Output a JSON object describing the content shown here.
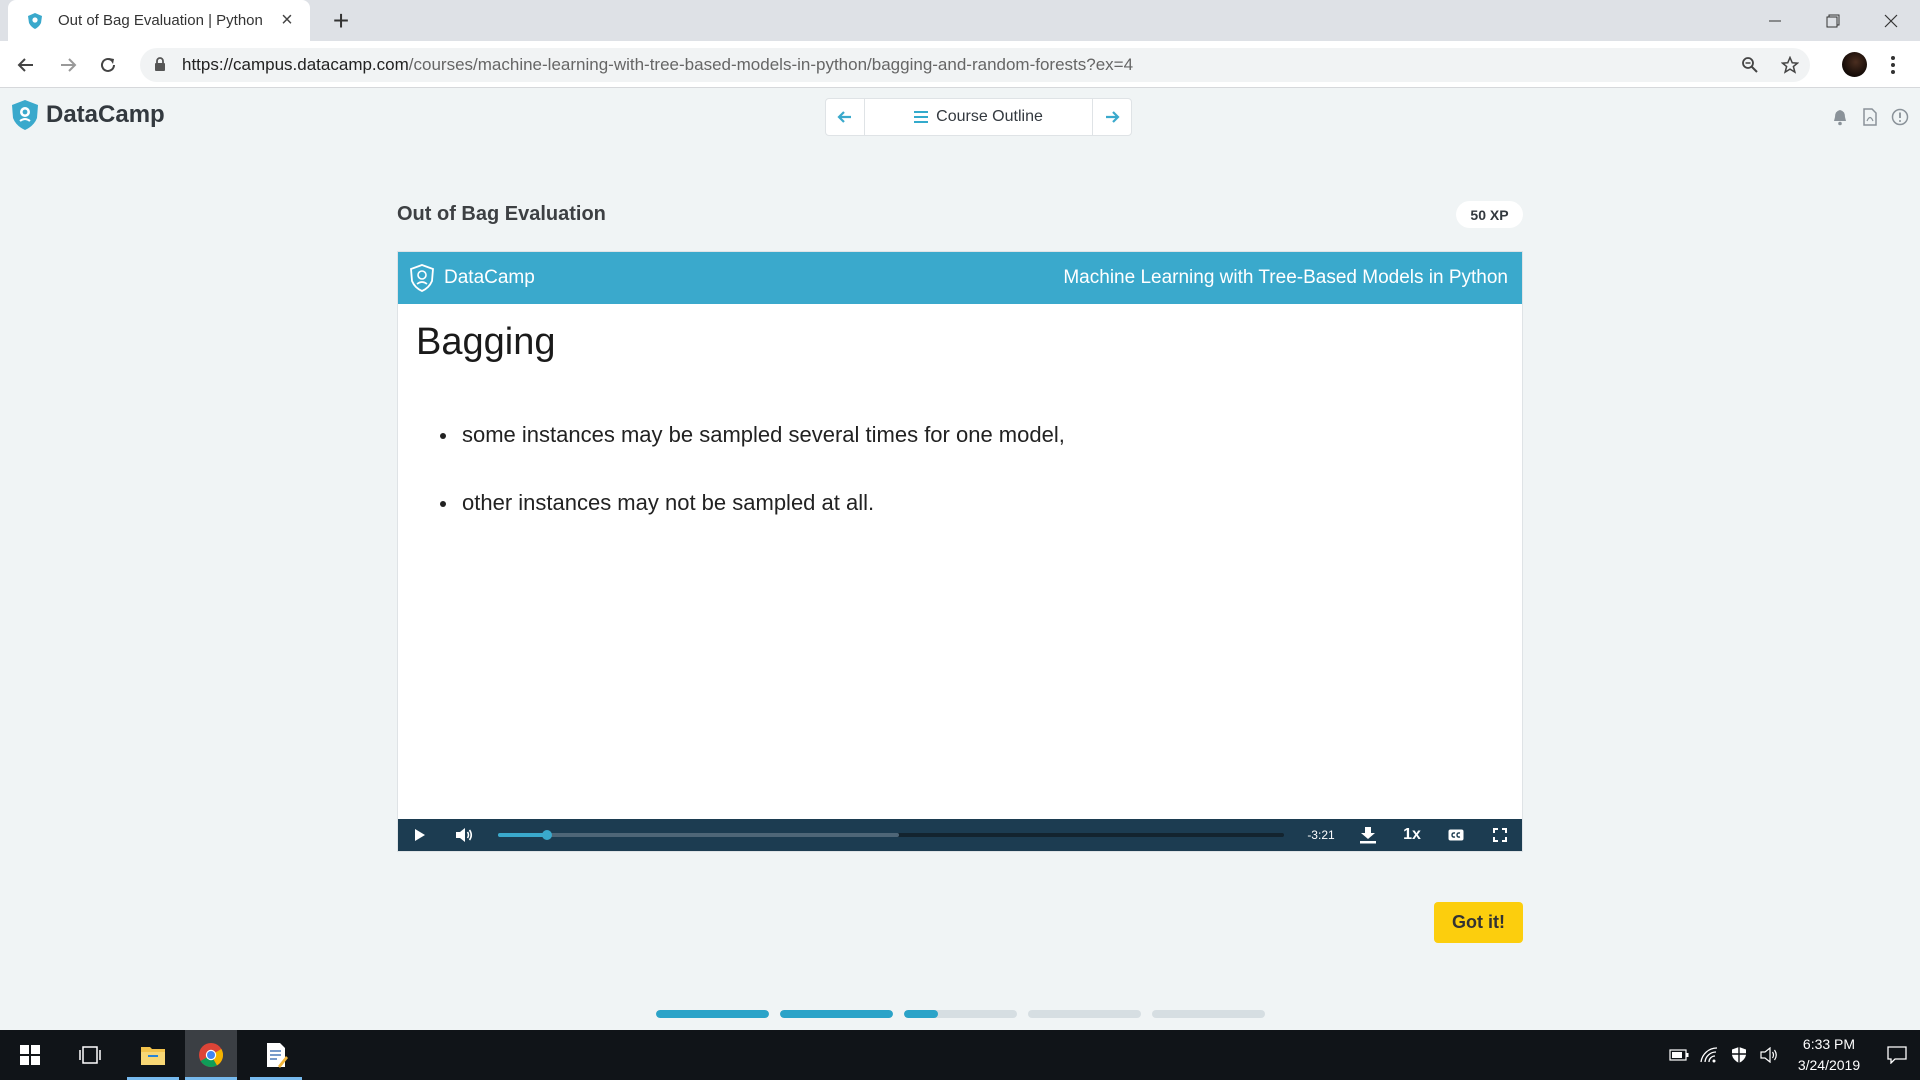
{
  "browser": {
    "tab_title": "Out of Bag Evaluation | Python",
    "url_host": "https://campus.datacamp.com",
    "url_path": "/courses/machine-learning-with-tree-based-models-in-python/bagging-and-random-forests?ex=4"
  },
  "app": {
    "brand": "DataCamp",
    "course_outline_label": "Course Outline",
    "accent_color": "#3aa9cc"
  },
  "exercise": {
    "title": "Out of Bag Evaluation",
    "xp": "50 XP",
    "got_it_label": "Got it!"
  },
  "slide": {
    "brand": "DataCamp",
    "course": "Machine Learning with Tree-Based Models in Python",
    "title": "Bagging",
    "bullets": [
      "some instances may be sampled several times for one model,",
      "other instances may not be sampled at all."
    ]
  },
  "player": {
    "time_remaining": "-3:21",
    "speed": "1x",
    "played_fraction": 0.062,
    "buffered_fraction": 0.51
  },
  "steps": [
    1.0,
    1.0,
    0.3,
    0.0,
    0.0
  ],
  "taskbar": {
    "time": "6:33 PM",
    "date": "3/24/2019"
  }
}
